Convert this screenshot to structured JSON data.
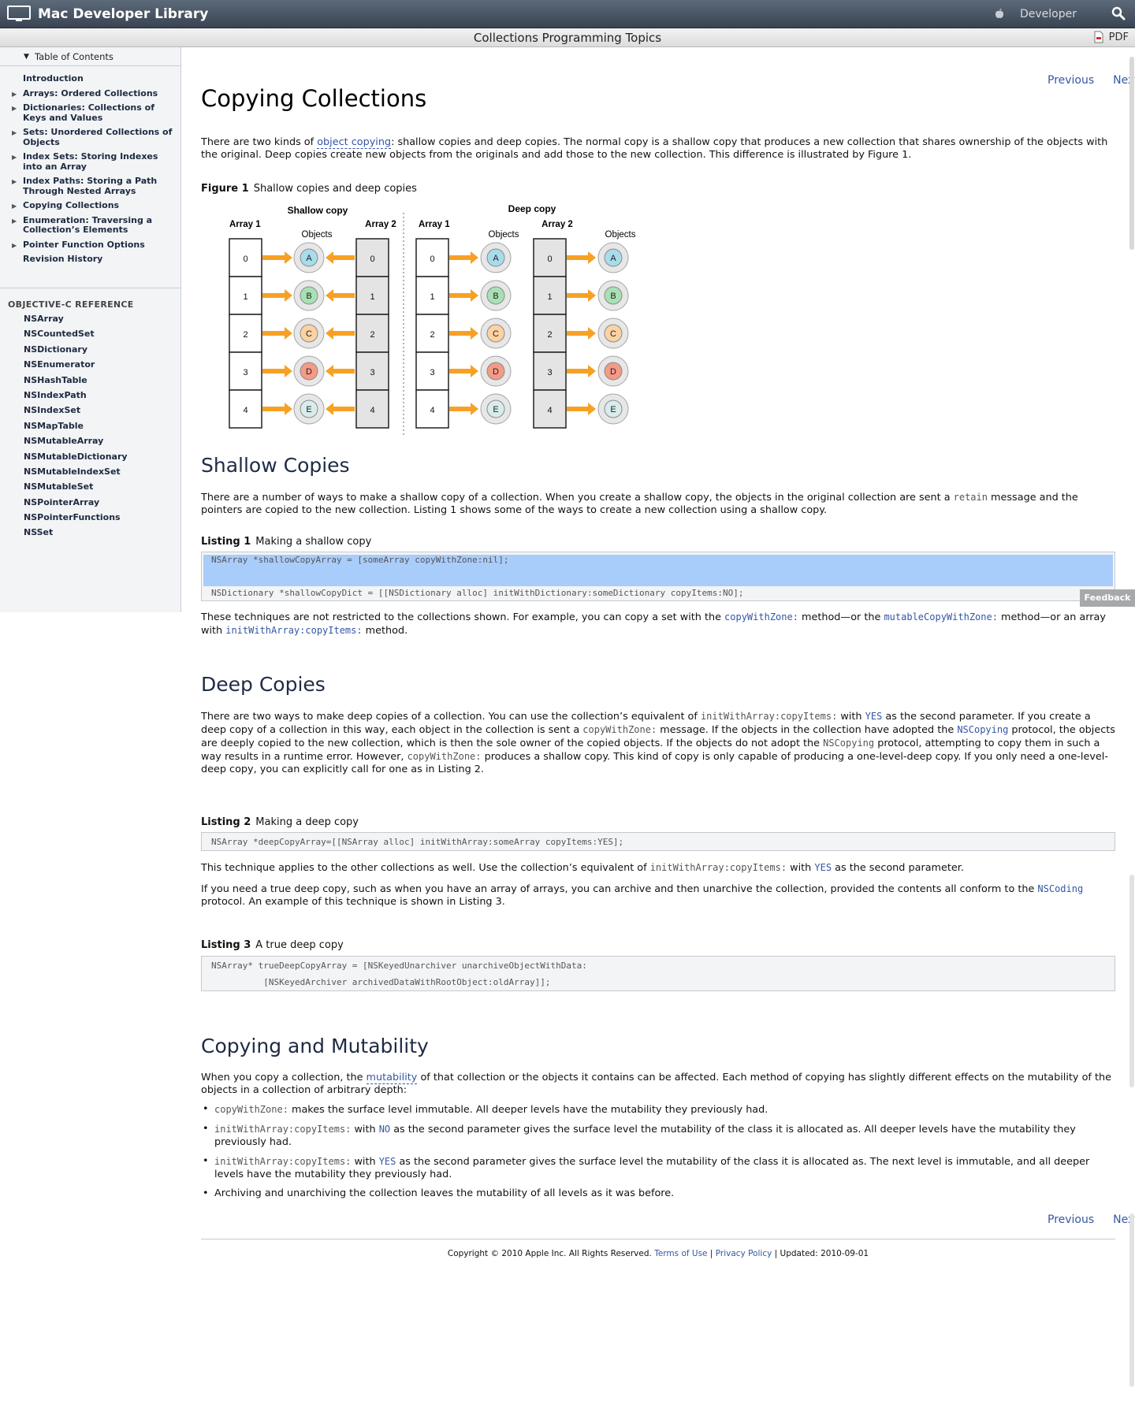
{
  "topbar": {
    "brand": "Mac Developer Library",
    "developer": "Developer"
  },
  "titlebar": {
    "title": "Collections Programming Topics",
    "pdf": "PDF"
  },
  "sidebar": {
    "toc_label": "Table of Contents",
    "items": [
      "Introduction",
      "Arrays: Ordered Collections",
      "Dictionaries: Collections of Keys and Values",
      "Sets: Unordered Collections of Objects",
      "Index Sets: Storing Indexes into an Array",
      "Index Paths: Storing a Path Through Nested Arrays",
      "Copying Collections",
      "Enumeration: Traversing a Collection’s Elements",
      "Pointer Function Options",
      "Revision History"
    ],
    "objc_heading": "OBJECTIVE-C REFERENCE",
    "refs": [
      "NSArray",
      "NSCountedSet",
      "NSDictionary",
      "NSEnumerator",
      "NSHashTable",
      "NSIndexPath",
      "NSIndexSet",
      "NSMapTable",
      "NSMutableArray",
      "NSMutableDictionary",
      "NSMutableIndexSet",
      "NSMutableSet",
      "NSPointerArray",
      "NSPointerFunctions",
      "NSSet"
    ]
  },
  "nav": {
    "previous": "Previous",
    "next": "Next"
  },
  "page": {
    "title": "Copying Collections",
    "intro": {
      "t1": "There are two kinds of ",
      "link": "object copying",
      "t2": ": shallow copies and deep copies. The normal copy is a shallow copy that produces a new collection that shares ownership of the objects with the original. Deep copies create new objects from the originals and add those to the new collection. This difference is illustrated by Figure 1."
    },
    "figure": {
      "num": "Figure 1",
      "caption": "Shallow copies and deep copies",
      "shallow_label": "Shallow copy",
      "deep_label": "Deep copy",
      "array1": "Array 1",
      "array2": "Array 2",
      "objects": "Objects",
      "indices": [
        "0",
        "1",
        "2",
        "3",
        "4"
      ],
      "letters": [
        "A",
        "B",
        "C",
        "D",
        "E"
      ],
      "colors": [
        "#a8dceb",
        "#a8e0b4",
        "#fcd2a4",
        "#f49a86",
        "#d8ecec"
      ],
      "arrow_color": "#f7a124"
    },
    "shallow": {
      "heading": "Shallow Copies",
      "p1": "There are a number of ways to make a shallow copy of a collection. When you create a shallow copy, the objects in the original collection are sent a ",
      "p1_code": "retain",
      "p1_end": " message and the pointers are copied to the new collection. Listing 1 shows some of the ways to create a new collection using a shallow copy.",
      "listing_num": "Listing 1",
      "listing_caption": "Making a shallow copy",
      "code1": "NSArray *shallowCopyArray = [someArray copyWithZone:nil];",
      "code2": "NSDictionary *shallowCopyDict = [[NSDictionary alloc] initWithDictionary:someDictionary copyItems:NO];",
      "p2_a": "These techniques are not restricted to the collections shown. For example, you can copy a set with the ",
      "p2_code1": "copyWithZone:",
      "p2_b": " method—or the ",
      "p2_code2": "mutableCopyWithZone:",
      "p2_c": " method—or an array with ",
      "p2_code3": "initWithArray:copyItems:",
      "p2_d": " method."
    },
    "deep": {
      "heading": "Deep Copies",
      "p1_a": "There are two ways to make deep copies of a collection. You can use the collection’s equivalent of ",
      "p1_code1": "initWithArray:copyItems:",
      "p1_b": " with ",
      "p1_yes": "YES",
      "p1_c": " as the second parameter. If you create a deep copy of a collection in this way, each object in the collection is sent a ",
      "p1_code2": "copyWithZone:",
      "p1_d": " message. If the objects in the collection have adopted the ",
      "p1_nscopying": "NSCopying",
      "p1_e": " protocol, the objects are deeply copied to the new collection, which is then the sole owner of the copied objects. If the objects do not adopt the ",
      "p1_code3": "NSCopying",
      "p1_f": " protocol, attempting to copy them in such a way results in a runtime error. However, ",
      "p1_code4": "copyWithZone:",
      "p1_g": " produces a shallow copy. This kind of copy is only capable of producing a one-level-deep copy. If you only need a one-level-deep copy, you can explicitly call for one as in Listing 2.",
      "listing2_num": "Listing 2",
      "listing2_caption": "Making a deep copy",
      "code2": "NSArray *deepCopyArray=[[NSArray alloc] initWithArray:someArray copyItems:YES];",
      "p2_a": "This technique applies to the other collections as well. Use the collection’s equivalent of ",
      "p2_code": "initWithArray:copyItems:",
      "p2_b": " with ",
      "p2_yes": "YES",
      "p2_c": " as the second parameter.",
      "p3_a": "If you need a true deep copy, such as when you have an array of arrays, you can archive and then unarchive the collection, provided the contents all conform to the ",
      "p3_link": "NSCoding",
      "p3_b": " protocol. An example of this technique is shown in Listing 3.",
      "listing3_num": "Listing 3",
      "listing3_caption": "A true deep copy",
      "code3a": "NSArray* trueDeepCopyArray = [NSKeyedUnarchiver unarchiveObjectWithData:",
      "code3b": "          [NSKeyedArchiver archivedDataWithRootObject:oldArray]];"
    },
    "mutability": {
      "heading": "Copying and Mutability",
      "p1_a": "When you copy a collection, the ",
      "p1_link": "mutability",
      "p1_b": " of that collection or the objects it contains can be affected. Each method of copying has slightly different effects on the mutability of the objects in a collection of arbitrary depth:",
      "b1_code": "copyWithZone:",
      "b1_text": " makes the surface level immutable. All deeper levels have the mutability they previously had.",
      "b2_code": "initWithArray:copyItems:",
      "b2_a": " with ",
      "b2_no": "NO",
      "b2_b": " as the second parameter gives the surface level the mutability of the class it is allocated as. All deeper levels have the mutability they previously had.",
      "b3_code": "initWithArray:copyItems:",
      "b3_a": " with ",
      "b3_yes": "YES",
      "b3_b": " as the second parameter gives the surface level the mutability of the class it is allocated as. The next level is immutable, and all deeper levels have the mutability they previously had.",
      "b4": "Archiving and unarchiving the collection leaves the mutability of all levels as it was before."
    },
    "footer": {
      "copyright": "Copyright © 2010 Apple Inc. All Rights Reserved. ",
      "terms": "Terms of Use",
      "sep1": " | ",
      "privacy": "Privacy Policy",
      "updated": " | Updated: 2010-09-01"
    }
  },
  "feedback": "Feedback"
}
